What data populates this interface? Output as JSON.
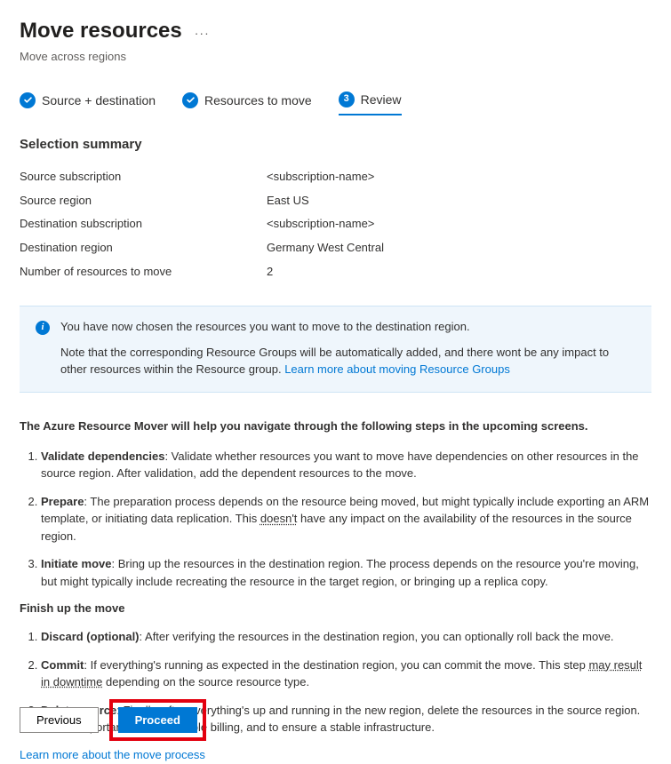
{
  "header": {
    "title": "Move resources",
    "subtitle": "Move across regions"
  },
  "stepper": {
    "step1": "Source + destination",
    "step2": "Resources to move",
    "step3_num": "3",
    "step3": "Review"
  },
  "summary": {
    "title": "Selection summary",
    "rows": {
      "src_sub_label": "Source subscription",
      "src_sub_value": "<subscription-name>",
      "src_region_label": "Source region",
      "src_region_value": "East US",
      "dst_sub_label": "Destination subscription",
      "dst_sub_value": "<subscription-name>",
      "dst_region_label": "Destination region",
      "dst_region_value": "Germany West Central",
      "count_label": "Number of resources to move",
      "count_value": "2"
    }
  },
  "info": {
    "line1": "You have now chosen the resources you want to move to the destination region.",
    "line2_prefix": "Note that the corresponding Resource Groups will be automatically added, and there wont be any impact to other resources within the Resource group. ",
    "link": "Learn more about moving Resource Groups"
  },
  "intro": "The Azure Resource Mover will help you navigate through the following steps in the upcoming screens.",
  "steps1": {
    "s1_title": "Validate dependencies",
    "s1_body": ": Validate whether resources you want to move have dependencies on other resources in the source region. After validation, add the dependent resources to the move.",
    "s2_title": "Prepare",
    "s2_body_a": ": The preparation process depends on the resource being moved, but might typically include exporting an ARM template, or initiating data replication. This ",
    "s2_underline": "doesn't",
    "s2_body_b": " have any impact on the availability of the resources in the source region.",
    "s3_title": "Initiate move",
    "s3_body": ": Bring up the resources in the destination region. The process depends on the resource you're moving, but might typically include recreating the resource in the target region, or bringing up a replica copy."
  },
  "finish_heading": "Finish up the move",
  "steps2": {
    "s1_title": "Discard (optional)",
    "s1_body": ": After verifying the resources in the destination region, you can optionally roll back the move.",
    "s2_title": "Commit",
    "s2_body_a": ": If everything's running as expected in the destination region, you can commit the move. This step ",
    "s2_underline": "may result in downtime",
    "s2_body_b": " depending on the source resource type.",
    "s3_title": "Delete source",
    "s3_body": ": Finally, after everything's up and running in the new region, delete the resources in the source region. This is important to avoid double billing, and to ensure a stable infrastructure."
  },
  "learn_more": "Learn more about the move process",
  "buttons": {
    "previous": "Previous",
    "proceed": "Proceed"
  }
}
